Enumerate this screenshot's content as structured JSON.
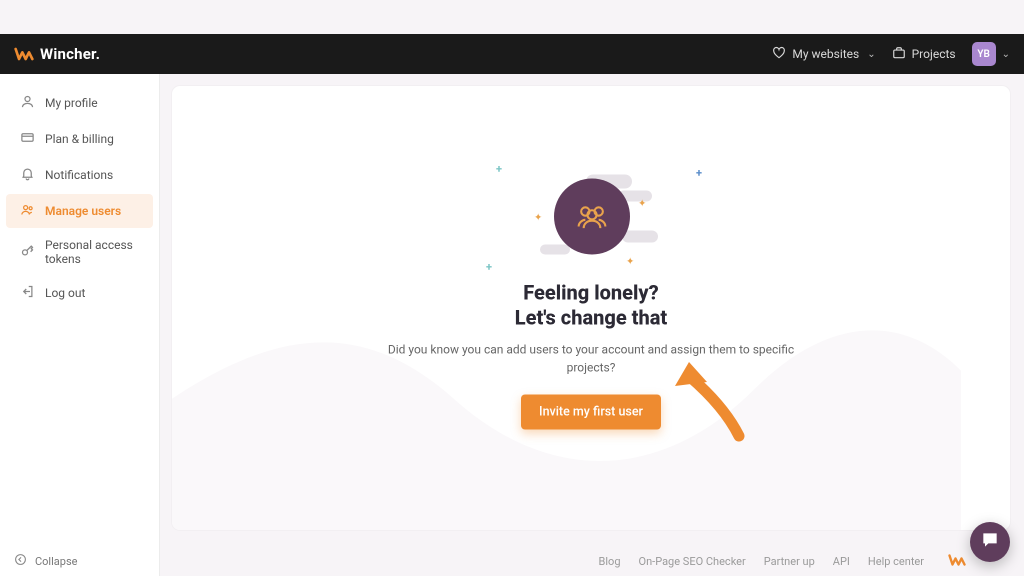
{
  "brand": {
    "name": "Wincher."
  },
  "topbar": {
    "mywebsites": "My websites",
    "projects": "Projects",
    "avatar_initials": "YB"
  },
  "sidebar": {
    "items": [
      {
        "label": "My profile"
      },
      {
        "label": "Plan & billing"
      },
      {
        "label": "Notifications"
      },
      {
        "label": "Manage users"
      },
      {
        "label": "Personal access tokens"
      },
      {
        "label": "Log out"
      }
    ],
    "collapse": "Collapse"
  },
  "empty_state": {
    "heading_line1": "Feeling lonely?",
    "heading_line2": "Let's change that",
    "subtext": "Did you know you can add users to your account and assign them to specific projects?",
    "cta": "Invite my first user"
  },
  "footer": {
    "links": [
      "Blog",
      "On-Page SEO Checker",
      "Partner up",
      "API",
      "Help center"
    ]
  },
  "colors": {
    "accent": "#ee8b30",
    "brand_purple": "#5f3d5c",
    "avatar_bg": "#a987cf"
  }
}
